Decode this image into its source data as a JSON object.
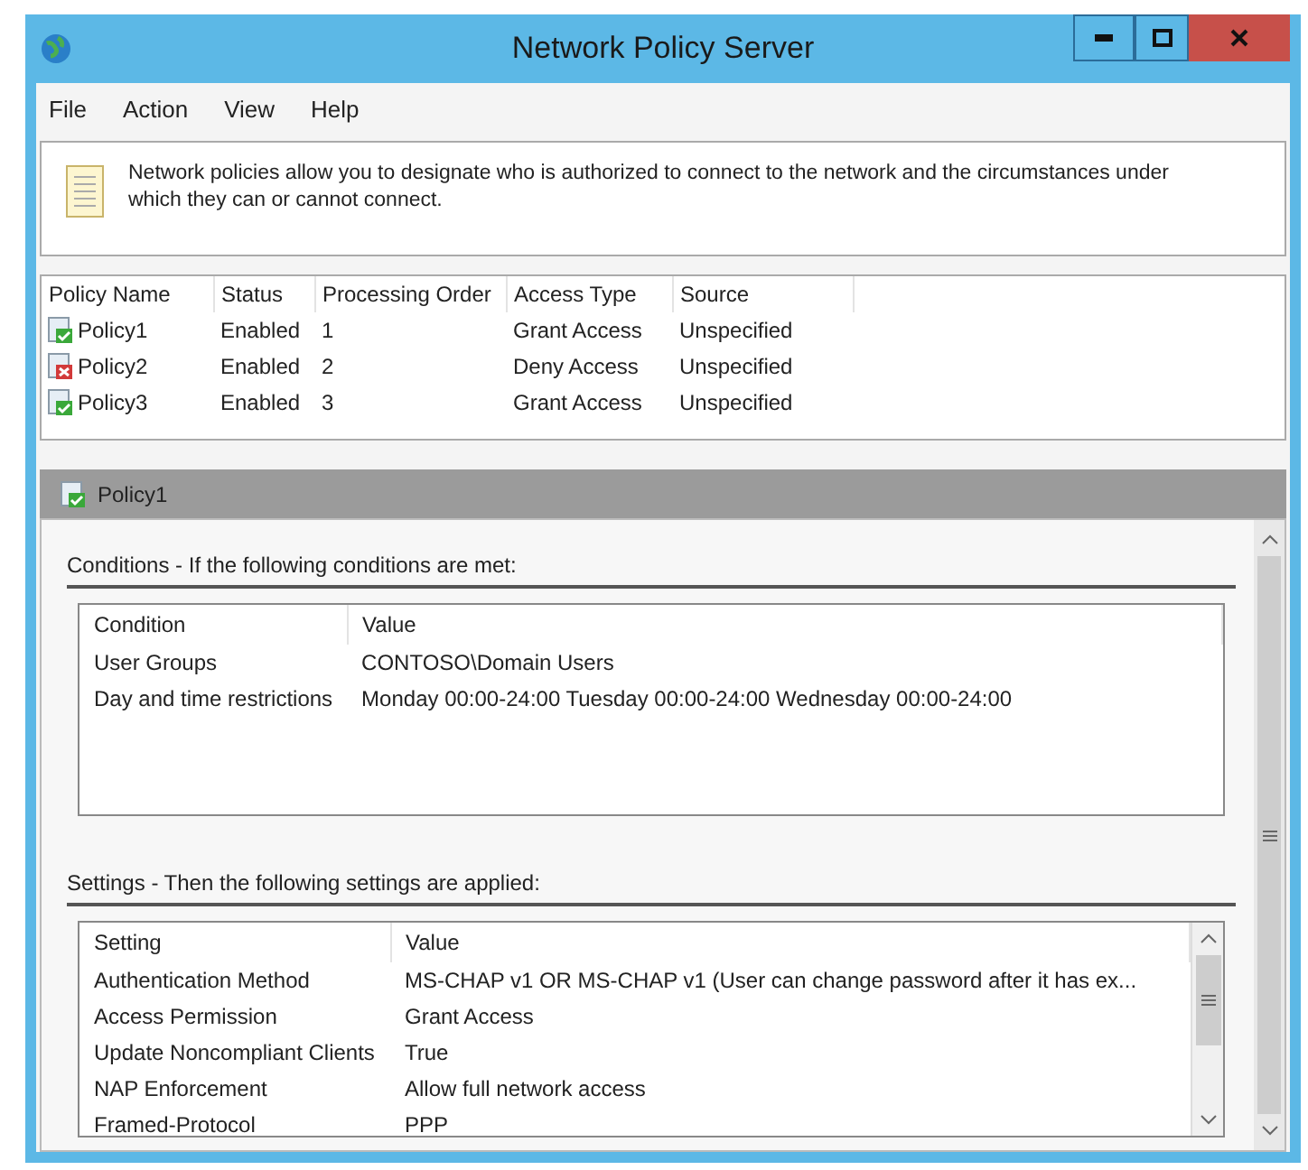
{
  "window": {
    "title": "Network Policy Server"
  },
  "menu": [
    "File",
    "Action",
    "View",
    "Help"
  ],
  "info": "Network policies allow you to designate who is authorized to connect to the network and the circumstances under which they can or cannot connect.",
  "policy_table": {
    "columns": [
      "Policy Name",
      "Status",
      "Processing Order",
      "Access Type",
      "Source"
    ],
    "rows": [
      {
        "kind": "grant",
        "cells": [
          "Policy1",
          "Enabled",
          "1",
          "Grant Access",
          "Unspecified"
        ]
      },
      {
        "kind": "deny",
        "cells": [
          "Policy2",
          "Enabled",
          "2",
          "Deny Access",
          "Unspecified"
        ]
      },
      {
        "kind": "grant",
        "cells": [
          "Policy3",
          "Enabled",
          "3",
          "Grant Access",
          "Unspecified"
        ]
      }
    ]
  },
  "detail": {
    "title": "Policy1",
    "kind": "grant",
    "conditions": {
      "heading": "Conditions - If the following conditions are met:",
      "columns": [
        "Condition",
        "Value"
      ],
      "rows": [
        [
          "User Groups",
          "CONTOSO\\Domain Users"
        ],
        [
          "Day and time restrictions",
          "Monday 00:00-24:00 Tuesday 00:00-24:00 Wednesday 00:00-24:00"
        ]
      ]
    },
    "settings": {
      "heading": "Settings - Then the following settings are applied:",
      "columns": [
        "Setting",
        "Value"
      ],
      "rows": [
        [
          "Authentication Method",
          "MS-CHAP v1 OR MS-CHAP v1 (User can change password after it has ex..."
        ],
        [
          "Access Permission",
          "Grant Access"
        ],
        [
          "Update Noncompliant Clients",
          "True"
        ],
        [
          "NAP Enforcement",
          "Allow full network access"
        ],
        [
          "Framed-Protocol",
          "PPP"
        ]
      ]
    }
  }
}
